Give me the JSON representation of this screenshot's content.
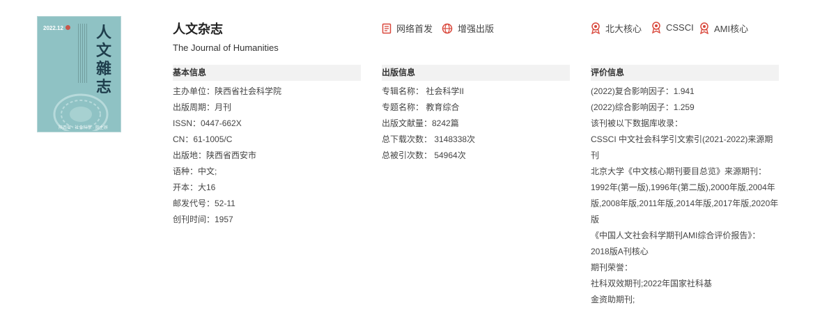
{
  "cover": {
    "issue": "2022.12",
    "title_calligraphy": "人文雜志",
    "bottom_text": "陝西省 · 社會科學 · 院主辦"
  },
  "journal": {
    "title": "人文杂志",
    "subtitle": "The Journal of Humanities"
  },
  "badges": [
    {
      "icon": "document-icon",
      "label": "网络首发"
    },
    {
      "icon": "globe-icon",
      "label": "增强出版"
    },
    {
      "icon": "award-icon",
      "label": "北大核心"
    },
    {
      "icon": "award-icon",
      "label": "CSSCI"
    },
    {
      "icon": "award-icon",
      "label": "AMI核心"
    }
  ],
  "sections": {
    "basic": {
      "heading": "基本信息",
      "rows": [
        "主办单位：陕西省社会科学院",
        "出版周期：月刊",
        "ISSN：0447-662X",
        "CN：61-1005/C",
        "出版地：陕西省西安市",
        "语种：中文;",
        "开本：大16",
        "邮发代号：52-11",
        "创刊时间：1957"
      ]
    },
    "publish": {
      "heading": "出版信息",
      "rows": [
        "专辑名称：  社会科学II",
        "专题名称：  教育综合",
        "出版文献量：8242篇",
        "总下载次数：  3148338次",
        "总被引次数：  54964次"
      ]
    },
    "eval": {
      "heading": "评价信息",
      "rows": [
        "(2022)复合影响因子：1.941",
        "(2022)综合影响因子：1.259",
        "该刊被以下数据库收录：",
        "CSSCI 中文社会科学引文索引(2021-2022)来源期刊",
        "北京大学《中文核心期刊要目总览》来源期刊：",
        "1992年(第一版),1996年(第二版),2000年版,2004年版,2008年版,2011年版,2014年版,2017年版,2020年版",
        "《中国人文社会科学期刊AMI综合评价报告》：",
        "2018版A刊核心",
        "期刊荣誉：",
        "社科双效期刊;2022年国家社科基",
        "金资助期刊;"
      ]
    }
  },
  "colors": {
    "accent_red": "#d9473b",
    "header_bg": "#f2f2f2",
    "cover_bg": "#8fc2c4"
  }
}
